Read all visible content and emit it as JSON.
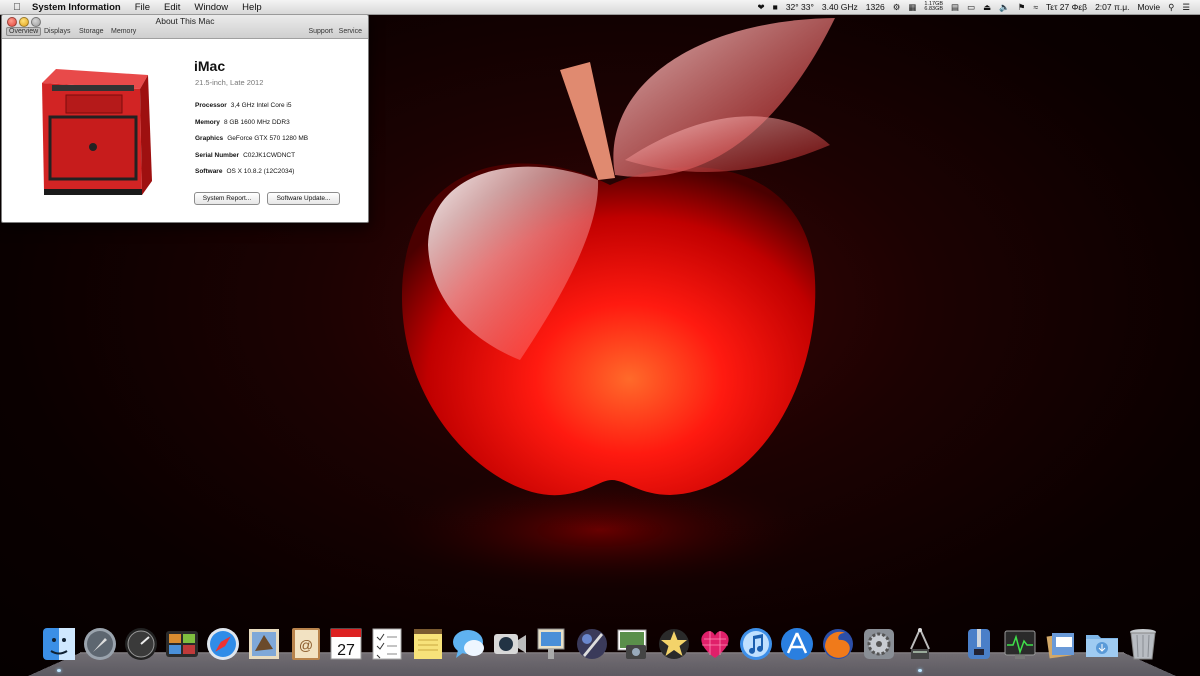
{
  "menubar": {
    "apple_icon": "apple-icon",
    "app_name": "System Information",
    "menus": [
      "File",
      "Edit",
      "Window",
      "Help"
    ],
    "status": {
      "temps": "32° 33°",
      "cpu_freq": "3.40 GHz",
      "fan": "1326",
      "mem_top": "1.17GB",
      "mem_bottom": "6.83GB",
      "date": "Τετ 27 Φεβ",
      "time": "2:07 π.μ.",
      "user": "Movie"
    }
  },
  "window": {
    "title": "About This Mac",
    "tabs": [
      "Overview",
      "Displays",
      "Storage",
      "Memory"
    ],
    "links": [
      "Support",
      "Service"
    ],
    "model": "iMac",
    "model_detail": "21.5-inch, Late 2012",
    "specs": [
      {
        "label": "Processor",
        "value": "3,4 GHz Intel Core i5"
      },
      {
        "label": "Memory",
        "value": "8 GB 1600 MHz DDR3"
      },
      {
        "label": "Graphics",
        "value": "GeForce GTX 570 1280 MB"
      },
      {
        "label": "Serial Number",
        "value": "C02JK1CWDNCT"
      },
      {
        "label": "Software",
        "value": "OS X 10.8.2 (12C2034)"
      }
    ],
    "buttons": {
      "report": "System Report...",
      "update": "Software Update..."
    }
  },
  "dock": {
    "items": [
      {
        "name": "finder",
        "icon": "finder-icon",
        "running": true
      },
      {
        "name": "launchpad",
        "icon": "launchpad-icon",
        "running": false
      },
      {
        "name": "dashboard",
        "icon": "dashboard-icon",
        "running": false
      },
      {
        "name": "mission-control",
        "icon": "mission-control-icon",
        "running": false
      },
      {
        "name": "safari",
        "icon": "safari-icon",
        "running": false
      },
      {
        "name": "mail",
        "icon": "mail-icon",
        "running": false
      },
      {
        "name": "contacts",
        "icon": "contacts-icon",
        "running": false
      },
      {
        "name": "calendar",
        "icon": "calendar-icon",
        "running": false,
        "label": "27"
      },
      {
        "name": "reminders",
        "icon": "reminders-icon",
        "running": false
      },
      {
        "name": "notes",
        "icon": "notes-icon",
        "running": false
      },
      {
        "name": "messages",
        "icon": "messages-icon",
        "running": false
      },
      {
        "name": "facetime",
        "icon": "facetime-icon",
        "running": false
      },
      {
        "name": "preview",
        "icon": "preview-icon",
        "running": false
      },
      {
        "name": "pixelmator",
        "icon": "pixelmator-icon",
        "running": false
      },
      {
        "name": "iphoto",
        "icon": "iphoto-icon",
        "running": false
      },
      {
        "name": "imovie",
        "icon": "imovie-icon",
        "running": false
      },
      {
        "name": "itunes-heart",
        "icon": "heart-app-icon",
        "running": false
      },
      {
        "name": "itunes",
        "icon": "itunes-icon",
        "running": false
      },
      {
        "name": "app-store",
        "icon": "app-store-icon",
        "running": false
      },
      {
        "name": "firefox",
        "icon": "firefox-icon",
        "running": false
      },
      {
        "name": "system-preferences",
        "icon": "system-preferences-icon",
        "running": false
      },
      {
        "name": "system-information",
        "icon": "system-information-icon",
        "running": true
      },
      {
        "name": "archive-utility",
        "icon": "archive-utility-icon",
        "running": false
      },
      {
        "name": "activity-monitor",
        "icon": "activity-monitor-icon",
        "running": false
      },
      {
        "name": "stack",
        "icon": "stack-icon",
        "running": false
      },
      {
        "name": "downloads",
        "icon": "downloads-folder-icon",
        "running": false
      },
      {
        "name": "trash",
        "icon": "trash-icon",
        "running": false
      }
    ]
  }
}
